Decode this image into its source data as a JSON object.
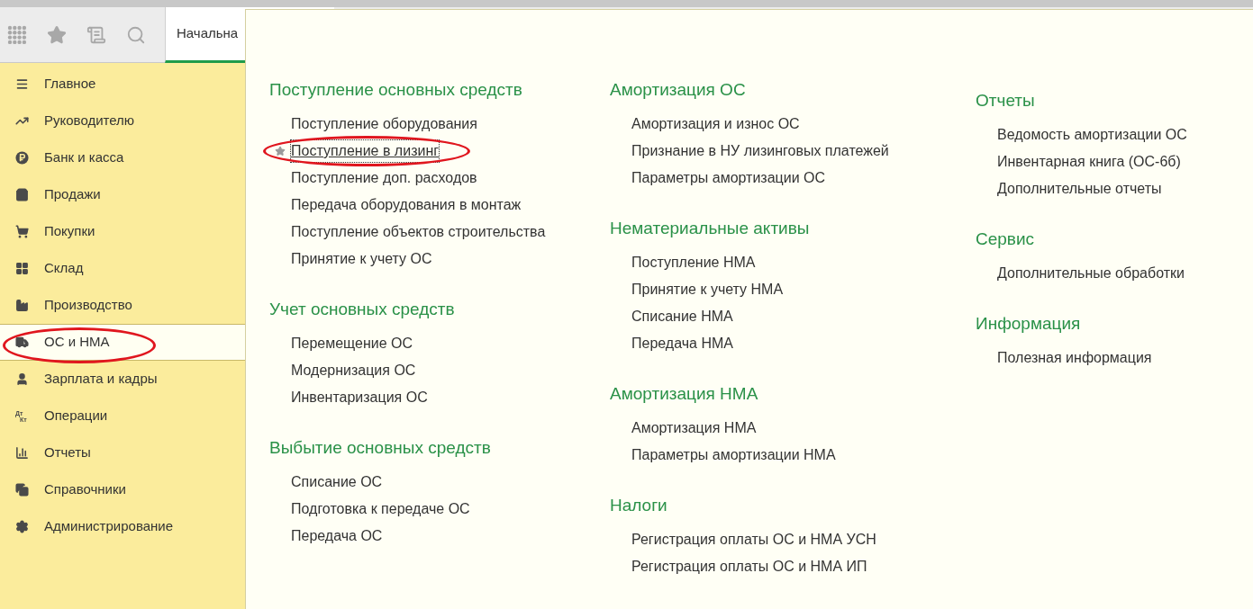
{
  "toolbar": {
    "tab": {
      "label": "Начальна",
      "selected": true
    }
  },
  "sidebar": {
    "items": [
      {
        "label": "Главное",
        "selected": false,
        "circled": false
      },
      {
        "label": "Руководителю",
        "selected": false,
        "circled": false
      },
      {
        "label": "Банк и касса",
        "selected": false,
        "circled": false
      },
      {
        "label": "Продажи",
        "selected": false,
        "circled": false
      },
      {
        "label": "Покупки",
        "selected": false,
        "circled": false
      },
      {
        "label": "Склад",
        "selected": false,
        "circled": false
      },
      {
        "label": "Производство",
        "selected": false,
        "circled": false
      },
      {
        "label": "ОС и НМА",
        "selected": true,
        "circled": true
      },
      {
        "label": "Зарплата и кадры",
        "selected": false,
        "circled": false
      },
      {
        "label": "Операции",
        "icon_text": [
          "Дт",
          "Кт"
        ],
        "selected": false,
        "circled": false
      },
      {
        "label": "Отчеты",
        "selected": false,
        "circled": false
      },
      {
        "label": "Справочники",
        "selected": false,
        "circled": false
      },
      {
        "label": "Администрирование",
        "selected": false,
        "circled": false
      }
    ]
  },
  "menu": {
    "columns": [
      [
        {
          "title": "Поступление основных средств",
          "items": [
            {
              "label": "Поступление оборудования",
              "favorite": false,
              "circled": false
            },
            {
              "label": "Поступление в лизинг",
              "favorite": true,
              "circled": true
            },
            {
              "label": "Поступление доп. расходов",
              "favorite": false,
              "circled": false
            },
            {
              "label": "Передача оборудования в монтаж",
              "favorite": false,
              "circled": false
            },
            {
              "label": "Поступление объектов строительства",
              "favorite": false,
              "circled": false
            },
            {
              "label": "Принятие к учету ОС",
              "favorite": false,
              "circled": false
            }
          ]
        },
        {
          "title": "Учет основных средств",
          "items": [
            {
              "label": "Перемещение ОС",
              "favorite": false,
              "circled": false
            },
            {
              "label": "Модернизация ОС",
              "favorite": false,
              "circled": false
            },
            {
              "label": "Инвентаризация ОС",
              "favorite": false,
              "circled": false
            }
          ]
        },
        {
          "title": "Выбытие основных средств",
          "items": [
            {
              "label": "Списание ОС",
              "favorite": false,
              "circled": false
            },
            {
              "label": "Подготовка к передаче ОС",
              "favorite": false,
              "circled": false
            },
            {
              "label": "Передача ОС",
              "favorite": false,
              "circled": false
            }
          ]
        }
      ],
      [
        {
          "title": "Амортизация ОС",
          "items": [
            {
              "label": "Амортизация и износ ОС",
              "favorite": false,
              "circled": false
            },
            {
              "label": "Признание в НУ лизинговых платежей",
              "favorite": false,
              "circled": false
            },
            {
              "label": "Параметры амортизации ОС",
              "favorite": false,
              "circled": false
            }
          ]
        },
        {
          "title": "Нематериальные активы",
          "items": [
            {
              "label": "Поступление НМА",
              "favorite": false,
              "circled": false
            },
            {
              "label": "Принятие к учету НМА",
              "favorite": false,
              "circled": false
            },
            {
              "label": "Списание НМА",
              "favorite": false,
              "circled": false
            },
            {
              "label": "Передача НМА",
              "favorite": false,
              "circled": false
            }
          ]
        },
        {
          "title": "Амортизация НМА",
          "items": [
            {
              "label": "Амортизация НМА",
              "favorite": false,
              "circled": false
            },
            {
              "label": "Параметры амортизации НМА",
              "favorite": false,
              "circled": false
            }
          ]
        },
        {
          "title": "Налоги",
          "items": [
            {
              "label": "Регистрация оплаты ОС и НМА УСН",
              "favorite": false,
              "circled": false
            },
            {
              "label": "Регистрация оплаты ОС и НМА ИП",
              "favorite": false,
              "circled": false
            }
          ]
        }
      ],
      [
        {
          "title": "Отчеты",
          "items": [
            {
              "label": "Ведомость амортизации ОС",
              "favorite": false,
              "circled": false
            },
            {
              "label": "Инвентарная книга (ОС-6б)",
              "favorite": false,
              "circled": false
            },
            {
              "label": "Дополнительные отчеты",
              "favorite": false,
              "circled": false
            }
          ]
        },
        {
          "title": "Сервис",
          "items": [
            {
              "label": "Дополнительные обработки",
              "favorite": false,
              "circled": false
            }
          ]
        },
        {
          "title": "Информация",
          "items": [
            {
              "label": "Полезная информация",
              "favorite": false,
              "circled": false
            }
          ]
        }
      ]
    ]
  }
}
